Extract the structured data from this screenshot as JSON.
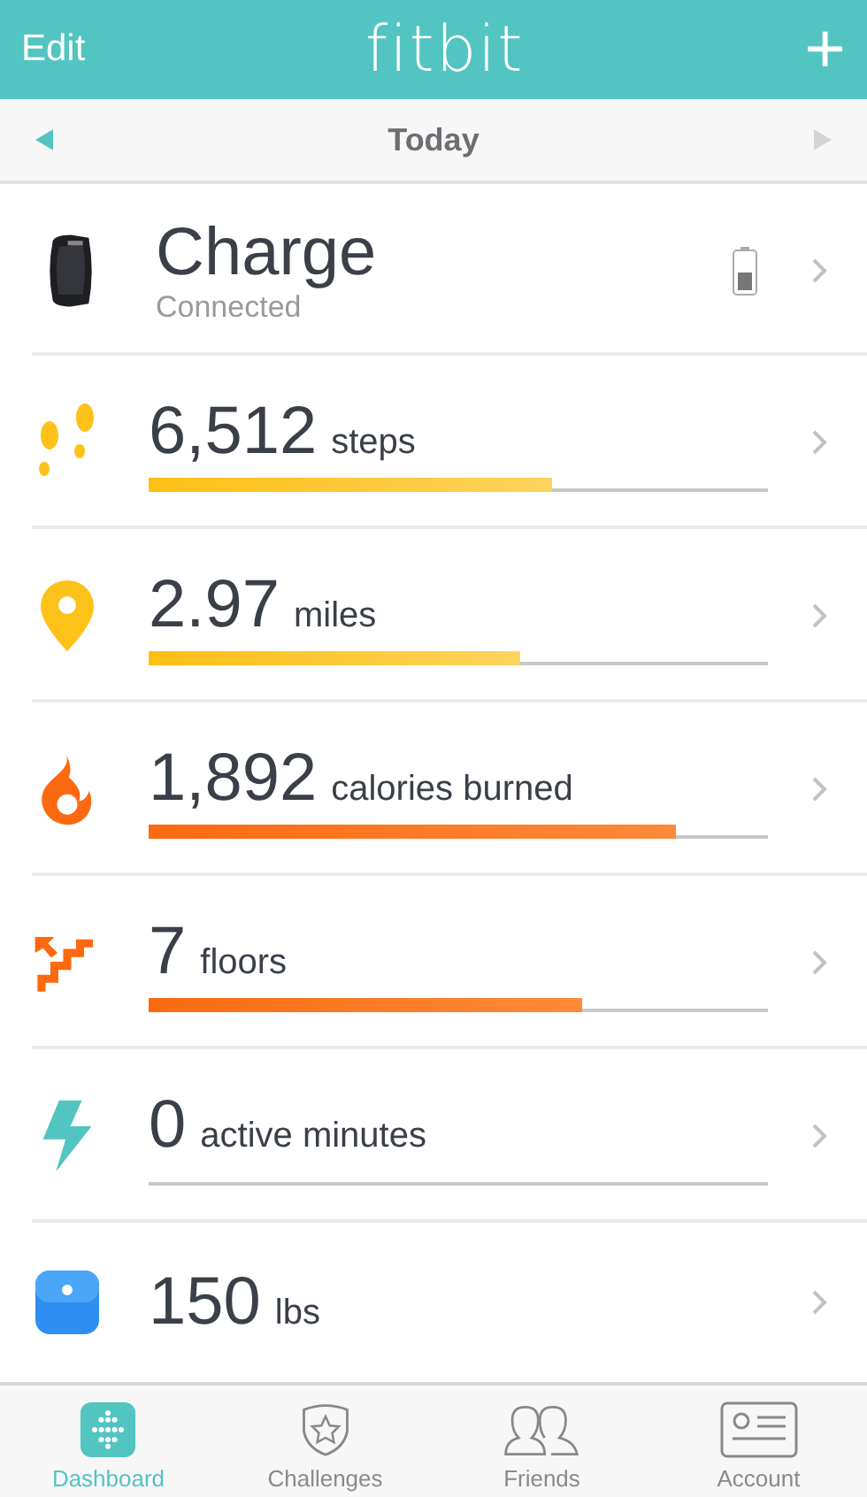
{
  "header": {
    "left": "Edit",
    "title": "fitbit",
    "right": "+"
  },
  "date_bar": {
    "label": "Today"
  },
  "device": {
    "name": "Charge",
    "status": "Connected"
  },
  "metrics": [
    {
      "kind": "steps",
      "value": "6,512",
      "unit": "steps",
      "level": 0.65
    },
    {
      "kind": "distance",
      "value": "2.97",
      "unit": "miles",
      "level": 0.6
    },
    {
      "kind": "calories",
      "value": "1,892",
      "unit": "calories burned",
      "level": 0.85
    },
    {
      "kind": "floors",
      "value": "7",
      "unit": "floors",
      "level": 0.7
    },
    {
      "kind": "active",
      "value": "0",
      "unit": "active minutes"
    },
    {
      "kind": "weight",
      "value": "150",
      "unit": "lbs"
    }
  ],
  "tabs": [
    {
      "kind": "dashboard",
      "label": "Dashboard",
      "selected": true
    },
    {
      "kind": "challenges",
      "label": "Challenges",
      "selected": false
    },
    {
      "kind": "friends",
      "label": "Friends",
      "selected": false
    },
    {
      "kind": "account",
      "label": "Account",
      "selected": false
    }
  ]
}
